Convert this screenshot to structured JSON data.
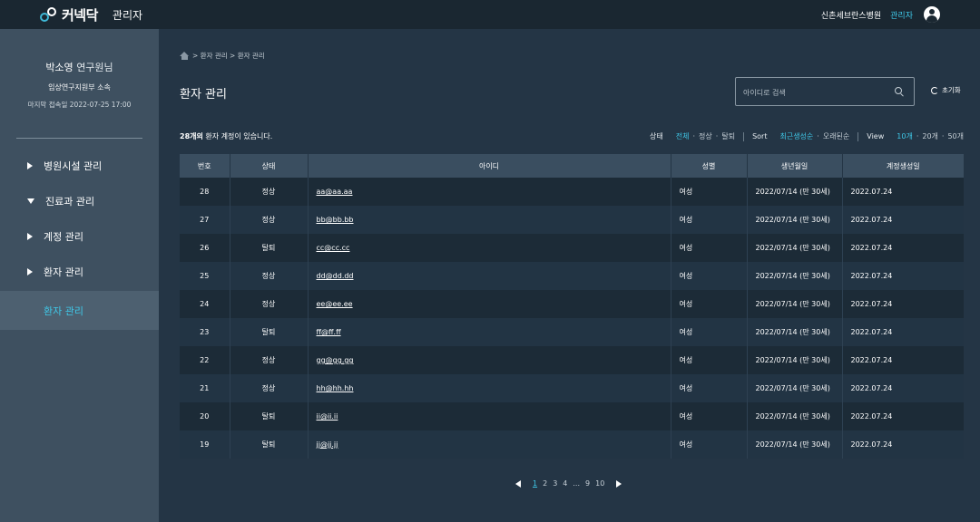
{
  "header": {
    "logo_text": "커넥닥",
    "section": "관리자",
    "hospital": "신촌세브란스병원",
    "role": "관리자"
  },
  "profile": {
    "name": "박소영",
    "title": "연구원님",
    "dept": "임상연구지원부 소속",
    "last_login": "마지막 접속일 2022-07-25 17:00"
  },
  "menu": [
    {
      "label": "병원시설 관리",
      "expanded": false
    },
    {
      "label": "진료과 관리",
      "expanded": true
    },
    {
      "label": "계정 관리",
      "expanded": false
    },
    {
      "label": "환자 관리",
      "expanded": false
    }
  ],
  "menu_sub": {
    "label": "환자 관리",
    "active": true
  },
  "breadcrumb": "> 환자 관리 > 환자 관리",
  "page_title": "환자 관리",
  "search": {
    "placeholder": "아이디로 검색",
    "value": ""
  },
  "reset_label": "초기화",
  "summary": {
    "count": "28개의",
    "rest": " 환자 계정이 있습니다."
  },
  "filters": {
    "status_label": "상태",
    "status_options": [
      "전체",
      "정상",
      "탈퇴"
    ],
    "status_active": 0,
    "sort_label": "Sort",
    "sort_options": [
      "최근생성순",
      "오래된순"
    ],
    "sort_active": 0,
    "view_label": "View",
    "view_options": [
      "10개",
      "20개",
      "50개"
    ],
    "view_active": 0
  },
  "table": {
    "headers": [
      "번호",
      "상태",
      "아이디",
      "성별",
      "생년월일",
      "계정생성일"
    ],
    "rows": [
      {
        "no": "28",
        "status": "정상",
        "id": "aa@aa.aa",
        "gender": "여성",
        "birth": "2022/07/14 (만 30세)",
        "created": "2022.07.24"
      },
      {
        "no": "27",
        "status": "정상",
        "id": "bb@bb.bb",
        "gender": "여성",
        "birth": "2022/07/14 (만 30세)",
        "created": "2022.07.24"
      },
      {
        "no": "26",
        "status": "탈퇴",
        "id": "cc@cc.cc",
        "gender": "여성",
        "birth": "2022/07/14 (만 30세)",
        "created": "2022.07.24"
      },
      {
        "no": "25",
        "status": "정상",
        "id": "dd@dd.dd",
        "gender": "여성",
        "birth": "2022/07/14 (만 30세)",
        "created": "2022.07.24"
      },
      {
        "no": "24",
        "status": "정상",
        "id": "ee@ee.ee",
        "gender": "여성",
        "birth": "2022/07/14 (만 30세)",
        "created": "2022.07.24"
      },
      {
        "no": "23",
        "status": "탈퇴",
        "id": "ff@ff.ff",
        "gender": "여성",
        "birth": "2022/07/14 (만 30세)",
        "created": "2022.07.24"
      },
      {
        "no": "22",
        "status": "정상",
        "id": "gg@gg.gg",
        "gender": "여성",
        "birth": "2022/07/14 (만 30세)",
        "created": "2022.07.24"
      },
      {
        "no": "21",
        "status": "정상",
        "id": "hh@hh.hh",
        "gender": "여성",
        "birth": "2022/07/14 (만 30세)",
        "created": "2022.07.24"
      },
      {
        "no": "20",
        "status": "탈퇴",
        "id": "ii@ii.ii",
        "gender": "여성",
        "birth": "2022/07/14 (만 30세)",
        "created": "2022.07.24"
      },
      {
        "no": "19",
        "status": "탈퇴",
        "id": "jj@jj.jj",
        "gender": "여성",
        "birth": "2022/07/14 (만 30세)",
        "created": "2022.07.24"
      }
    ]
  },
  "pagination": {
    "pages": [
      "1",
      "2",
      "3",
      "4",
      "...",
      "9",
      "10"
    ],
    "current": "1"
  }
}
